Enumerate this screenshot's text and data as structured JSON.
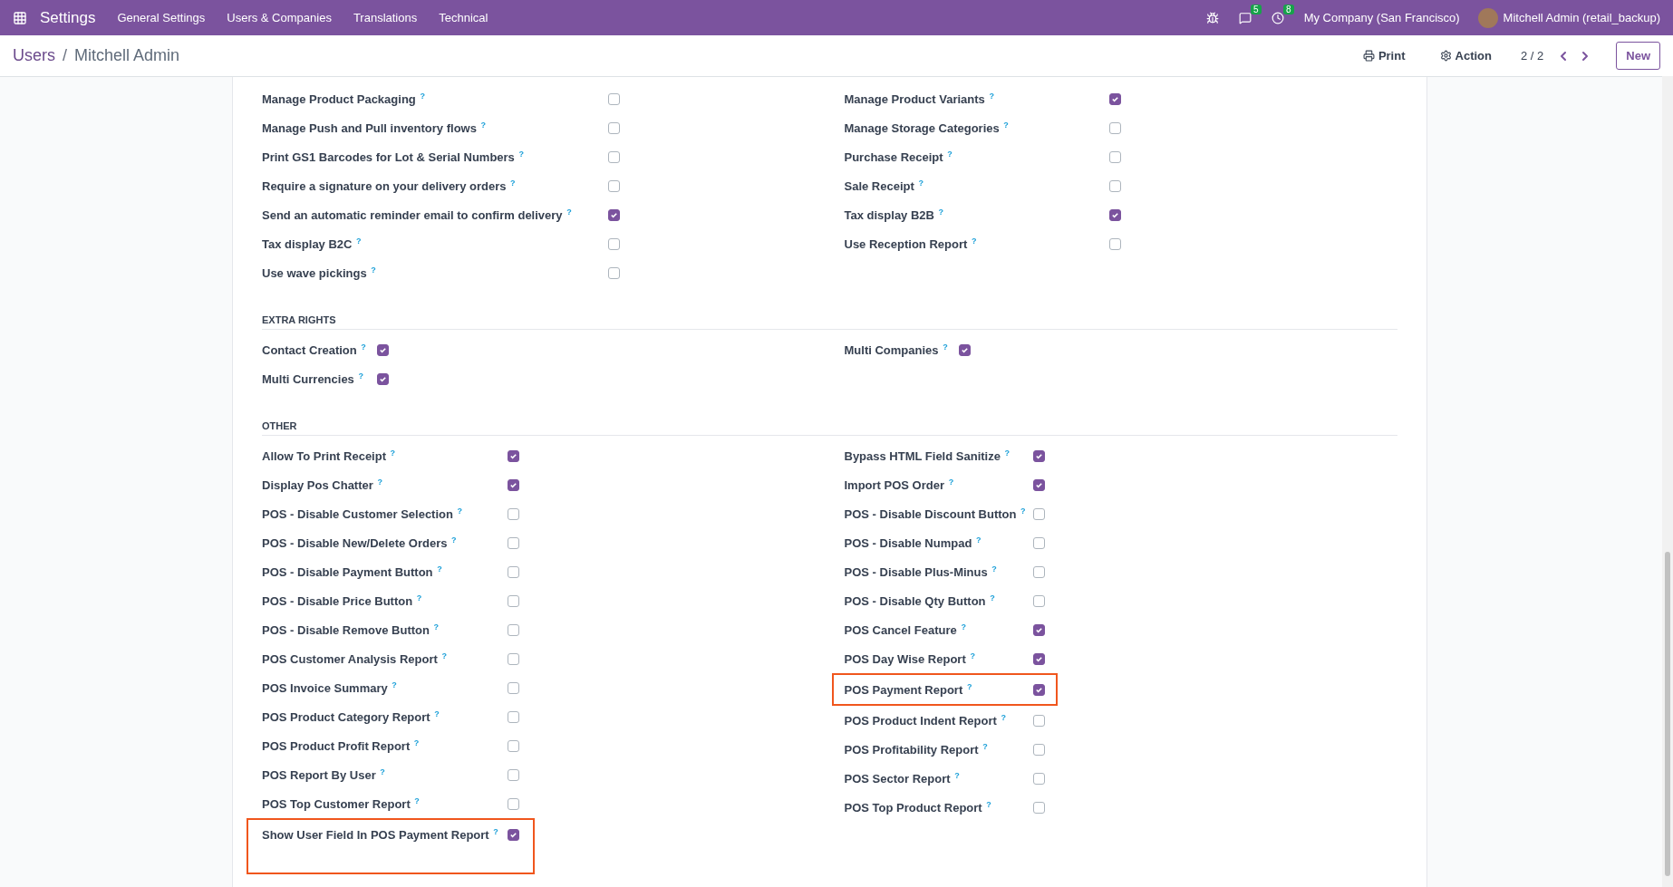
{
  "navbar": {
    "app": "Settings",
    "menu": [
      "General Settings",
      "Users & Companies",
      "Translations",
      "Technical"
    ],
    "systray": [
      {
        "kind": "bug"
      },
      {
        "kind": "chat",
        "badge": "5"
      },
      {
        "kind": "clock",
        "badge": "8"
      }
    ],
    "company": "My Company (San Francisco)",
    "user": "Mitchell Admin (retail_backup)"
  },
  "control_panel": {
    "breadcrumb": [
      "Users",
      "/",
      "Mitchell Admin"
    ],
    "print": "Print",
    "action": "Action",
    "pager": "2 / 2",
    "new_button": "New"
  },
  "sections": [
    {
      "columns": [
        [
          {
            "label": "Manage Product Packaging $^{?}$",
            "checked": false,
            "highlighted": false
          },
          {
            "label": "Manage Push and Pull inventory flows $^{?}$",
            "checked": false,
            "highlighted": false
          },
          {
            "label": "Print GS1 Barcodes for Lot & Serial Numbers $^{?}$",
            "checked": false,
            "highlighted": false
          },
          {
            "label": "Require a signature on your delivery orders $^{?}$",
            "checked": false,
            "highlighted": false
          },
          {
            "label": "Send an automatic reminder email to confirm delivery $^{?}$",
            "checked": true,
            "highlighted": false
          },
          {
            "label": "Tax display B2C $^{?}$",
            "checked": false,
            "highlighted": false
          },
          {
            "label": "Use wave pickings $^{?}$",
            "checked": false,
            "highlighted": false
          }
        ],
        [
          {
            "label": "Manage Product Variants $^{?}$",
            "checked": true,
            "highlighted": false
          },
          {
            "label": "Manage Storage Categories $^{?}$",
            "checked": false,
            "highlighted": false
          },
          {
            "label": "Purchase Receipt $^{?}$",
            "checked": false,
            "highlighted": false
          },
          {
            "label": "Sale Receipt $^{?}$",
            "checked": false,
            "highlighted": false
          },
          {
            "label": "Tax display B2B $^{?}$",
            "checked": true,
            "highlighted": false
          },
          {
            "label": "Use Reception Report $^{?}$",
            "checked": false,
            "highlighted": false
          }
        ]
      ]
    },
    {
      "title": "EXTRA RIGHTS",
      "columns": [
        [
          {
            "label": "Contact Creation $^{?}$",
            "checked": true,
            "highlighted": false
          },
          {
            "label": "Multi Currencies $^{?}$",
            "checked": true,
            "highlighted": false
          }
        ],
        [
          {
            "label": "Multi Companies $^{?}$",
            "checked": true,
            "highlighted": false
          }
        ]
      ]
    },
    {
      "title": "OTHER",
      "columns": [
        [
          {
            "label": "Allow To Print Receipt $^{?}$",
            "checked": true,
            "highlighted": false
          },
          {
            "label": "Display Pos Chatter $^{?}$",
            "checked": true,
            "highlighted": false
          },
          {
            "label": "POS - Disable Customer Selection $^{?}$",
            "checked": false,
            "highlighted": false
          },
          {
            "label": "POS - Disable New/Delete Orders $^{?}$",
            "checked": false,
            "highlighted": false
          },
          {
            "label": "POS - Disable Payment Button $^{?}$",
            "checked": false,
            "highlighted": false
          },
          {
            "label": "POS - Disable Price Button $^{?}$",
            "checked": false,
            "highlighted": false
          },
          {
            "label": "POS - Disable Remove Button $^{?}$",
            "checked": false,
            "highlighted": false
          },
          {
            "label": "POS Customer Analysis Report $^{?}$",
            "checked": false,
            "highlighted": false
          },
          {
            "label": "POS Invoice Summary $^{?}$",
            "checked": false,
            "highlighted": false
          },
          {
            "label": "POS Product Category Report $^{?}$",
            "checked": false,
            "highlighted": false
          },
          {
            "label": "POS Product Profit Report $^{?}$",
            "checked": false,
            "highlighted": false
          },
          {
            "label": "POS Report By User $^{?}$",
            "checked": false,
            "highlighted": false
          },
          {
            "label": "POS Top Customer Report $^{?}$",
            "checked": false,
            "highlighted": false
          },
          {
            "label": "Show User Field In POS Payment Report $^{?}$",
            "checked": true,
            "highlighted": true
          }
        ],
        [
          {
            "label": "Bypass HTML Field Sanitize $^{?}$",
            "checked": true,
            "highlighted": false
          },
          {
            "label": "Import POS Order $^{?}$",
            "checked": true,
            "highlighted": false
          },
          {
            "label": "POS - Disable Discount Button $^{?}$",
            "checked": false,
            "highlighted": false
          },
          {
            "label": "POS - Disable Numpad $^{?}$",
            "checked": false,
            "highlighted": false
          },
          {
            "label": "POS - Disable Plus-Minus $^{?}$",
            "checked": false,
            "highlighted": false
          },
          {
            "label": "POS - Disable Qty Button $^{?}$",
            "checked": false,
            "highlighted": false
          },
          {
            "label": "POS Cancel Feature $^{?}$",
            "checked": true,
            "highlighted": false
          },
          {
            "label": "POS Day Wise Report $^{?}$",
            "checked": true,
            "highlighted": false
          },
          {
            "label": "POS Payment Report $^{?}$",
            "checked": true,
            "highlighted": true
          },
          {
            "label": "POS Product Indent Report $^{?}$",
            "checked": false,
            "highlighted": false
          },
          {
            "label": "POS Profitability Report $^{?}$",
            "checked": false,
            "highlighted": false
          },
          {
            "label": "POS Sector Report $^{?}$",
            "checked": false,
            "highlighted": false
          },
          {
            "label": "POS Top Product Report $^{?}$",
            "checked": false,
            "highlighted": false
          }
        ]
      ]
    }
  ]
}
